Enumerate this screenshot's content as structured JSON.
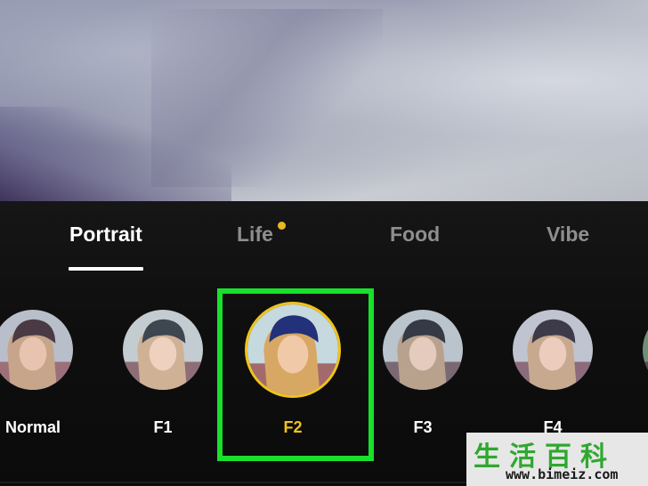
{
  "tabs": [
    {
      "label": "Portrait",
      "active": true
    },
    {
      "label": "Life",
      "active": false,
      "has_dot": true
    },
    {
      "label": "Food",
      "active": false
    },
    {
      "label": "Vibe",
      "active": false
    }
  ],
  "filters": [
    {
      "label": "Normal",
      "selected": false
    },
    {
      "label": "F1",
      "selected": false
    },
    {
      "label": "F2",
      "selected": true
    },
    {
      "label": "F3",
      "selected": false
    },
    {
      "label": "F4",
      "selected": false
    },
    {
      "label": "",
      "selected": false
    }
  ],
  "watermark": {
    "chinese": "生活百科",
    "url": "www.bimeiz.com"
  },
  "colors": {
    "selected_ring": "#f0c419",
    "highlight_box": "#17e12b",
    "notification_dot": "#e9b822",
    "tab_active": "#ffffff",
    "tab_inactive": "#8e8e8e"
  }
}
